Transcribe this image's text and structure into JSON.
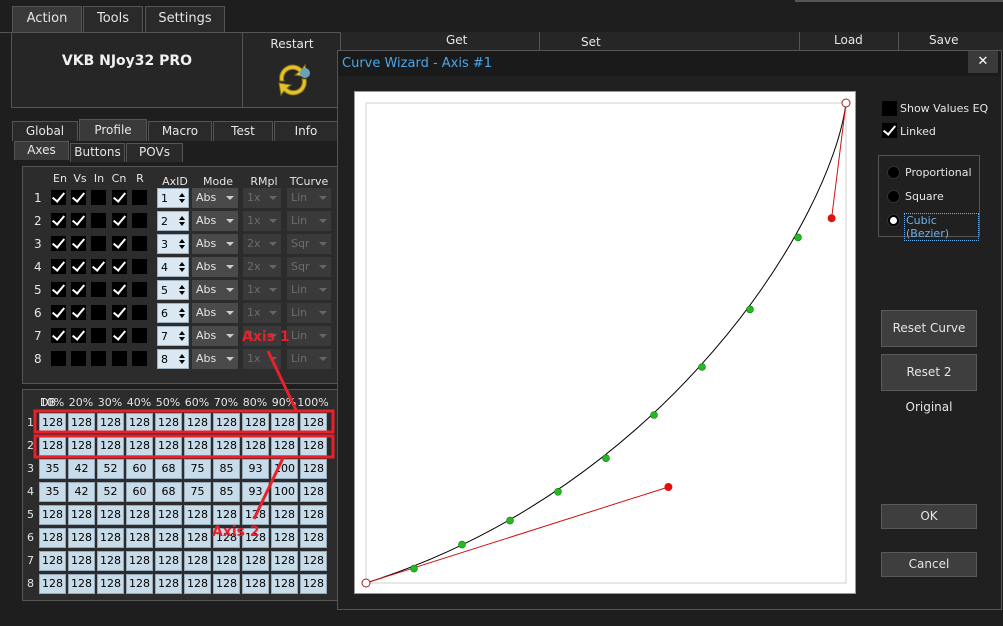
{
  "menu": {
    "action": "Action",
    "tools": "Tools",
    "settings": "Settings"
  },
  "device": {
    "name": "VKB NJoy32 PRO",
    "restart": "Restart"
  },
  "toolbar": {
    "get": "Get",
    "set": "Set",
    "load": "Load",
    "save": "Save"
  },
  "tabs": {
    "global": "Global",
    "profile": "Profile",
    "macro": "Macro",
    "test": "Test",
    "info": "Info"
  },
  "subtabs": {
    "axes": "Axes",
    "buttons": "Buttons",
    "povs": "POVs"
  },
  "axes_table": {
    "headers": {
      "en": "En",
      "vs": "Vs",
      "in": "In",
      "cn": "Cn",
      "r": "R",
      "axid": "AxID",
      "mode": "Mode",
      "rmpl": "RMpl",
      "tcurve": "TCurve"
    },
    "rows": [
      {
        "num": "1",
        "en": true,
        "vs": true,
        "in": false,
        "cn": true,
        "r": false,
        "axid": "1",
        "mode": "Abs",
        "rmpl": "1x",
        "tcurve": "Lin"
      },
      {
        "num": "2",
        "en": true,
        "vs": true,
        "in": false,
        "cn": true,
        "r": false,
        "axid": "2",
        "mode": "Abs",
        "rmpl": "1x",
        "tcurve": "Lin"
      },
      {
        "num": "3",
        "en": true,
        "vs": true,
        "in": false,
        "cn": true,
        "r": false,
        "axid": "3",
        "mode": "Abs",
        "rmpl": "2x",
        "tcurve": "Sqr"
      },
      {
        "num": "4",
        "en": true,
        "vs": true,
        "in": true,
        "cn": true,
        "r": false,
        "axid": "4",
        "mode": "Abs",
        "rmpl": "2x",
        "tcurve": "Sqr"
      },
      {
        "num": "5",
        "en": true,
        "vs": true,
        "in": false,
        "cn": true,
        "r": false,
        "axid": "5",
        "mode": "Abs",
        "rmpl": "1x",
        "tcurve": "Lin"
      },
      {
        "num": "6",
        "en": true,
        "vs": true,
        "in": false,
        "cn": true,
        "r": false,
        "axid": "6",
        "mode": "Abs",
        "rmpl": "1x",
        "tcurve": "Lin"
      },
      {
        "num": "7",
        "en": true,
        "vs": true,
        "in": false,
        "cn": true,
        "r": false,
        "axid": "7",
        "mode": "Abs",
        "rmpl": "1x",
        "tcurve": "Lin"
      },
      {
        "num": "8",
        "en": false,
        "vs": false,
        "in": false,
        "cn": false,
        "r": false,
        "axid": "8",
        "mode": "Abs",
        "rmpl": "1x",
        "tcurve": "Lin"
      }
    ]
  },
  "curve_table": {
    "corner": "DB",
    "headers": [
      "10%",
      "20%",
      "30%",
      "40%",
      "50%",
      "60%",
      "70%",
      "80%",
      "90%",
      "100%"
    ],
    "rows": [
      {
        "num": "1",
        "values": [
          "128",
          "128",
          "128",
          "128",
          "128",
          "128",
          "128",
          "128",
          "128",
          "128"
        ]
      },
      {
        "num": "2",
        "values": [
          "128",
          "128",
          "128",
          "128",
          "128",
          "128",
          "128",
          "128",
          "128",
          "128"
        ]
      },
      {
        "num": "3",
        "values": [
          "35",
          "42",
          "52",
          "60",
          "68",
          "75",
          "85",
          "93",
          "100",
          "128"
        ]
      },
      {
        "num": "4",
        "values": [
          "35",
          "42",
          "52",
          "60",
          "68",
          "75",
          "85",
          "93",
          "100",
          "128"
        ]
      },
      {
        "num": "5",
        "values": [
          "128",
          "128",
          "128",
          "128",
          "128",
          "128",
          "128",
          "128",
          "128",
          "128"
        ]
      },
      {
        "num": "6",
        "values": [
          "128",
          "128",
          "128",
          "128",
          "128",
          "128",
          "128",
          "128",
          "128",
          "128"
        ]
      },
      {
        "num": "7",
        "values": [
          "128",
          "128",
          "128",
          "128",
          "128",
          "128",
          "128",
          "128",
          "128",
          "128"
        ]
      },
      {
        "num": "8",
        "values": [
          "128",
          "128",
          "128",
          "128",
          "128",
          "128",
          "128",
          "128",
          "128",
          "128"
        ]
      }
    ]
  },
  "annotations": {
    "axis1": "Axis 1",
    "axis2": "Axis 2",
    "color": "#e8202a"
  },
  "dialog": {
    "title": "Curve Wizard - Axis #1",
    "close": "✕",
    "show_values_eq": {
      "label": "Show Values EQ",
      "checked": false
    },
    "linked": {
      "label": "Linked",
      "checked": true
    },
    "curve_types": [
      {
        "label": "Proportional",
        "selected": false
      },
      {
        "label": "Square",
        "selected": false
      },
      {
        "label": "Cubic (Bezier)",
        "selected": true
      }
    ],
    "reset_curve": "Reset Curve",
    "reset_original": "Reset 2 Original",
    "ok": "OK",
    "cancel": "Cancel"
  },
  "curve": {
    "start": [
      0,
      0
    ],
    "end": [
      100,
      100
    ],
    "control1": [
      63,
      20
    ],
    "control2": [
      97,
      76
    ],
    "points": [
      [
        10,
        3
      ],
      [
        20,
        8
      ],
      [
        30,
        13
      ],
      [
        40,
        19
      ],
      [
        50,
        26
      ],
      [
        60,
        35
      ],
      [
        70,
        45
      ],
      [
        80,
        57
      ],
      [
        90,
        72
      ]
    ],
    "colors": {
      "line": "#000000",
      "handle": "#d01010",
      "point": "#22bb22",
      "endpoint": "#ffffff"
    }
  }
}
